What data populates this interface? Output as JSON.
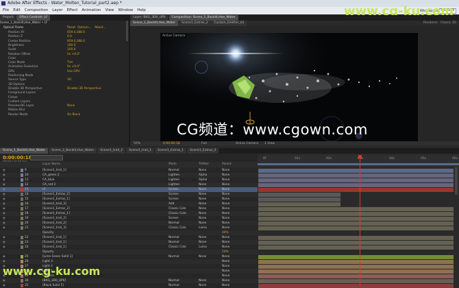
{
  "app": {
    "title": "Adobe After Effects - Water_Molten_Tutorial_part2.aep *",
    "workspace_label": "Workspace:",
    "workspace_value": "Standard"
  },
  "menu": [
    "File",
    "Edit",
    "Composition",
    "Layer",
    "Effect",
    "Animation",
    "View",
    "Window",
    "Help"
  ],
  "watermark": "www.cg-ku.com",
  "overlay_text": "CG频道：www.cgown.com",
  "left_tabs": [
    "Project",
    "Effect Controls: LF"
  ],
  "effect_controls": {
    "layer_path": "Scene_1_Backlit,Hoe_Water • LF",
    "effect_name": "Optical Flares",
    "reset_label": "Reset",
    "options_label": "Options...",
    "about_label": "About...",
    "params": [
      {
        "name": "Position XY",
        "value": "659.0,388.0"
      },
      {
        "name": "Position Z",
        "value": "0.0"
      },
      {
        "name": "Center Position",
        "value": "959.0,388.0"
      },
      {
        "name": "Brightness",
        "value": "100.0"
      },
      {
        "name": "Scale",
        "value": "100.0"
      },
      {
        "name": "Rotation Offset",
        "value": "0x +0.0°"
      },
      {
        "name": "Color",
        "value": ""
      },
      {
        "name": "Color Mode",
        "value": "Tint"
      },
      {
        "name": "Animation Evolution",
        "value": "0x +0.0°"
      },
      {
        "name": "GPU",
        "value": "Use GPU"
      },
      {
        "name": "Positioning Mode",
        "value": ""
      },
      {
        "name": "Source Type",
        "value": "3D"
      },
      {
        "name": "3D Options",
        "value": ""
      },
      {
        "name": "Disable 3D Perspective",
        "value": "Disable 3D Perspective"
      },
      {
        "name": "Foreground Layers",
        "value": ""
      },
      {
        "name": "Flicker",
        "value": ""
      },
      {
        "name": "Custom Layers",
        "value": ""
      },
      {
        "name": "Preview BG Layer",
        "value": "None"
      },
      {
        "name": "Motion Blur",
        "value": ""
      },
      {
        "name": "Render Mode",
        "value": "On Black"
      }
    ]
  },
  "viewer_tabs": [
    "Layer: BKG_3D0_UP0",
    "Composition: Scene_1_Backlit,Hoe_Water"
  ],
  "viewer_subtabs": [
    "Scene_1_Backlit,Hoe_Water",
    "Scene1_Extras_2",
    "Custom_Emitter_01"
  ],
  "renderer": {
    "label": "Renderer:",
    "value": "Classic 3D"
  },
  "active_camera_label": "Active Camera",
  "viewer_controls": {
    "zoom": "50%",
    "timecode": "0:00:00:18",
    "resolution": "Full",
    "camera": "Active Camera",
    "view": "1 View"
  },
  "timeline_tabs": [
    "Scene_1_Backlit,Hoe_Water",
    "Scene_2_Backlit,Hoe_Water",
    "Scene1_trail_2",
    "Scene1_trail_1",
    "Scene1_Extras_1",
    "Scene1_Extras_2"
  ],
  "timecode": "0:00:00:18",
  "frames": "00018 (24.00 fps)",
  "columns": {
    "name": "Layer Name",
    "mode": "Mode",
    "trkmat": "TrkMat",
    "parent": "Parent"
  },
  "ruler_labels": [
    "0f",
    "01s",
    "02s",
    "03s",
    "04s",
    "05s",
    "06s"
  ],
  "layers": [
    {
      "num": "9",
      "name": "[Scene1_trail_1]",
      "mode": "Normal",
      "trk": "None",
      "parent": "None",
      "color": "#6f7fa8"
    },
    {
      "num": "10",
      "name": "CA_green 2",
      "mode": "Lighten",
      "trk": "Alpha",
      "parent": "None",
      "color": "#7a7a9a"
    },
    {
      "num": "11",
      "name": "CA_blue",
      "mode": "Lighten",
      "trk": "Alpha",
      "parent": "None",
      "color": "#7a7a9a"
    },
    {
      "num": "12",
      "name": "CA_red 2",
      "mode": "Lighten",
      "trk": "None",
      "parent": "None",
      "color": "#7a7a9a"
    },
    {
      "num": "13",
      "name": "LF",
      "mode": "Screen",
      "trk": "None",
      "parent": "None",
      "color": "#c0392b"
    },
    {
      "num": "14",
      "name": "[Scene1_Extras_2]",
      "mode": "Screen",
      "trk": "None",
      "parent": "None",
      "color": "#6a6a6a"
    },
    {
      "num": "15",
      "name": "[Scene1_Extras_1]",
      "mode": "Screen",
      "trk": "None",
      "parent": "None",
      "color": "#6a6a6a"
    },
    {
      "num": "16",
      "name": "[Scene1_trail_3]",
      "mode": "Add",
      "trk": "None",
      "parent": "None",
      "color": "#7a7460"
    },
    {
      "num": "17",
      "name": "[Scene1_Extras_2]",
      "mode": "Classic Colo",
      "trk": "None",
      "parent": "None",
      "color": "#7a7460"
    },
    {
      "num": "18",
      "name": "[Scene1_Extras_1]",
      "mode": "Classic Colo",
      "trk": "None",
      "parent": "None",
      "color": "#7a7460"
    },
    {
      "num": "19",
      "name": "[Scene1_trail_2]",
      "mode": "Screen",
      "trk": "None",
      "parent": "None",
      "color": "#7a7460"
    },
    {
      "num": "20",
      "name": "[Scene1_trail_2]",
      "mode": "Normal",
      "trk": "None",
      "parent": "None",
      "color": "#7a7460"
    },
    {
      "num": "21",
      "name": "[Scene1_trail_3]",
      "mode": "Classic Colo",
      "trk": "Luma",
      "parent": "None",
      "color": "#7a7460"
    },
    {
      "num": "",
      "name": "Opacity",
      "mode": "",
      "trk": "",
      "parent": "40%",
      "color": ""
    },
    {
      "num": "22",
      "name": "[Scene1_trail_1]",
      "mode": "Normal",
      "trk": "None",
      "parent": "None",
      "color": "#7a7460"
    },
    {
      "num": "23",
      "name": "[Scene1_trail_1]",
      "mode": "Normal",
      "trk": "None",
      "parent": "None",
      "color": "#7a7460"
    },
    {
      "num": "24",
      "name": "[Scene1_trail_1]",
      "mode": "Classic Colo",
      "trk": "Luma",
      "parent": "None",
      "color": "#7a7460"
    },
    {
      "num": "",
      "name": "Opacity",
      "mode": "",
      "trk": "",
      "parent": "50%",
      "color": ""
    },
    {
      "num": "25",
      "name": "[Lime Green Solid 1]",
      "mode": "Normal",
      "trk": "None",
      "parent": "None",
      "color": "#8fae3a"
    },
    {
      "num": "26",
      "name": "Light 3",
      "mode": "",
      "trk": "",
      "parent": "None",
      "color": "#b08a60"
    },
    {
      "num": "27",
      "name": "Light 2",
      "mode": "",
      "trk": "",
      "parent": "None",
      "color": "#b08a60"
    },
    {
      "num": "28",
      "name": "Light 1",
      "mode": "",
      "trk": "",
      "parent": "None",
      "color": "#b08a60"
    },
    {
      "num": "29",
      "name": "Camera",
      "mode": "",
      "trk": "",
      "parent": "None",
      "color": "#b06e6e"
    },
    {
      "num": "30",
      "name": "[BKG_3D0_UP0]",
      "mode": "Normal",
      "trk": "None",
      "parent": "None",
      "color": "#7a7460"
    },
    {
      "num": "31",
      "name": "[Black Solid 5]",
      "mode": "Normal",
      "trk": "None",
      "parent": "None",
      "color": "#a44"
    }
  ]
}
